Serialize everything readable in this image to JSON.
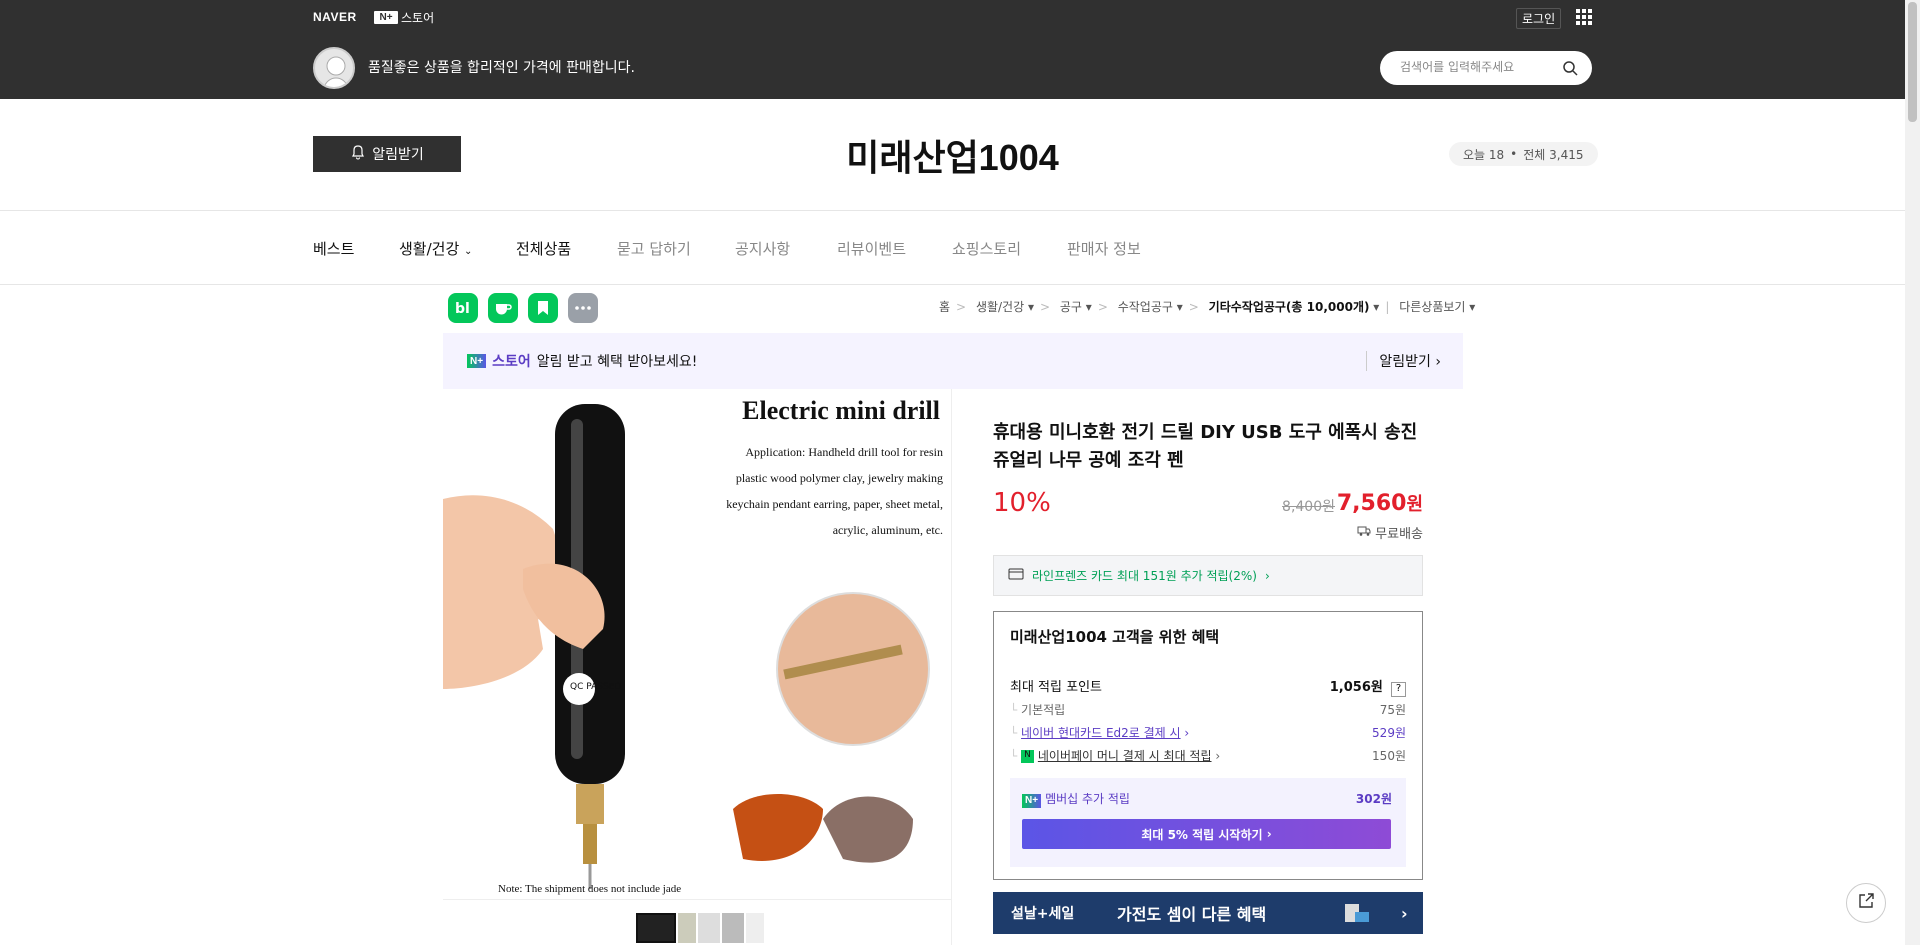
{
  "topbar": {
    "naver_logo": "NAVER",
    "nplus_badge": "N+",
    "nplus_label": "스토어",
    "login": "로그인",
    "tagline": "품질좋은 상품을 합리적인 가격에 판매합니다.",
    "search_placeholder": "검색어를 입력해주세요"
  },
  "store": {
    "alarm_button": "알림받기",
    "name": "미래산업1004",
    "visits_today": "오늘 18",
    "visits_total": "전체 3,415"
  },
  "nav": {
    "items": [
      "베스트",
      "생활/건강",
      "전체상품",
      "묻고 답하기",
      "공지사항",
      "리뷰이벤트",
      "쇼핑스토리",
      "판매자 정보"
    ]
  },
  "apps": [
    "bl",
    "cafe",
    "bookmark",
    "more"
  ],
  "breadcrumb": {
    "items": [
      "홈",
      "생활/건강",
      "공구",
      "수작업공구",
      "기타수작업공구(총 10,000개)",
      "다른상품보기"
    ]
  },
  "banner": {
    "badge": "N+",
    "brand": "스토어",
    "text": "알림 받고 혜택 받아보세요!",
    "action": "알림받기"
  },
  "product_image": {
    "title": "Electric mini drill",
    "application": "Application: Handheld drill tool for resin plastic wood polymer clay, jewelry making keychain pendant earring, paper, sheet metal, acrylic, aluminum, etc.",
    "note": "Note: The shipment does not include jade",
    "qc_label": "QC PASSED"
  },
  "product": {
    "title": "휴대용 미니호환 전기 드릴 DIY USB 도구 에폭시 송진 쥬얼리 나무 공예 조각 펜",
    "discount": "10%",
    "original_price": "8,400원",
    "price": "7,560",
    "currency": "원",
    "shipping": "무료배송",
    "card_benefit": "라인프렌즈 카드 최대 151원 추가 적립(2%)"
  },
  "benefits": {
    "title": "미래산업1004 고객을 위한 혜택",
    "max_points_label": "최대 적립 포인트",
    "max_points_value": "1,056원",
    "help": "?",
    "rows": [
      {
        "label": "기본적립",
        "value": "75원"
      },
      {
        "label": "네이버 현대카드 Ed2로 결제 시",
        "value": "529원"
      },
      {
        "label": "네이버페이 머니 결제 시 최대 적립",
        "value": "150원"
      }
    ],
    "membership_label": "멤버십 추가 적립",
    "membership_value": "302원",
    "membership_button": "최대 5% 적립 시작하기"
  },
  "promo": {
    "left": "설날+세일",
    "right": "가전도 셈이 다른 혜택"
  },
  "colors": {
    "topbar": "#303030",
    "accent_red": "#e2202c",
    "naver_green": "#03c75a",
    "purple": "#5b3cc4"
  }
}
